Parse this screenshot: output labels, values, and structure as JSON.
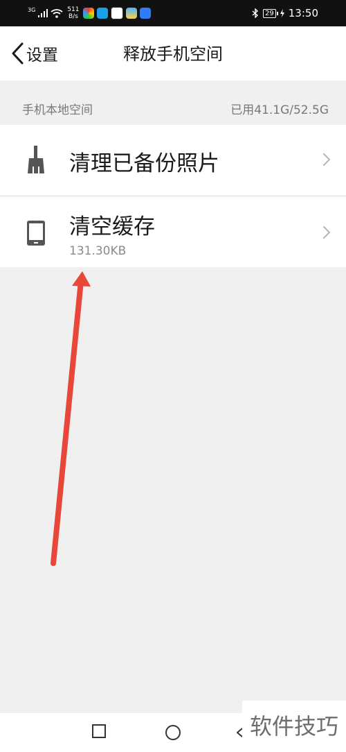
{
  "status_bar": {
    "network": "3G",
    "speed_value": "511",
    "speed_unit": "B/s",
    "battery": "29",
    "time": "13:50"
  },
  "header": {
    "back_label": "设置",
    "title": "释放手机空间"
  },
  "storage": {
    "section_title": "手机本地空间",
    "usage": "已用41.1G/52.5G"
  },
  "items": [
    {
      "title": "清理已备份照片",
      "icon": "broom-icon"
    },
    {
      "title": "清空缓存",
      "subtitle": "131.30KB",
      "icon": "phone-icon"
    }
  ],
  "annotation": {
    "color": "#e8473a"
  },
  "nav": {
    "recent_icon": "square-icon",
    "home_icon": "circle-icon",
    "back_icon": "triangle-back-icon"
  },
  "watermark": "软件技巧"
}
